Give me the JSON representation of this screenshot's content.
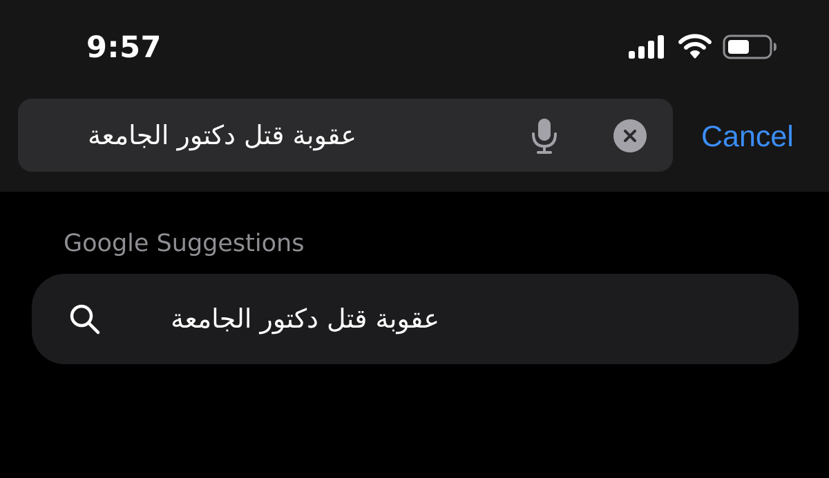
{
  "status_bar": {
    "time": "9:57",
    "icons": [
      "cellular-signal-icon",
      "wifi-icon",
      "battery-icon"
    ]
  },
  "search": {
    "value": "عقوبة قتل دكتور الجامعة",
    "mic_icon": "microphone-icon",
    "clear_icon": "clear-x-icon",
    "cancel_label": "Cancel"
  },
  "suggestions": {
    "header": "Google Suggestions",
    "items": [
      {
        "icon": "search-icon",
        "text": "عقوبة قتل دكتور الجامعة"
      }
    ]
  },
  "colors": {
    "background": "#000000",
    "top_bar": "#161616",
    "search_field": "#2b2b2d",
    "suggestion_row": "#1c1c1e",
    "accent": "#3b8ef7",
    "secondary_text": "#8e8e93",
    "clear_button": "#a2a2a8"
  }
}
